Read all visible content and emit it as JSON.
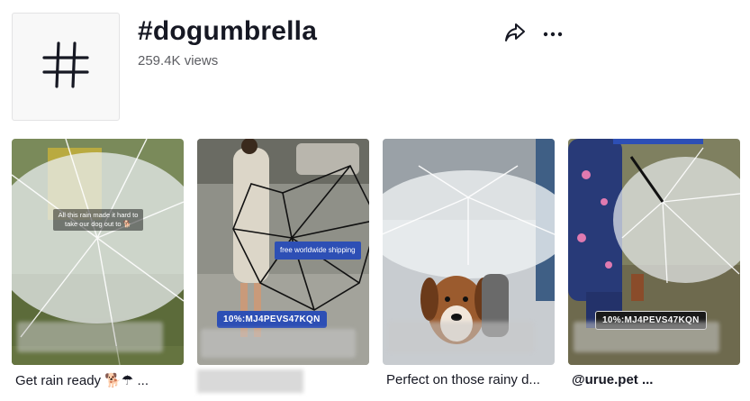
{
  "header": {
    "title": "#dogumbrella",
    "views": "259.4K views",
    "hashtag_icon": "hashtag-icon",
    "share_icon": "share-arrow-icon",
    "more_icon": "more-dots-icon"
  },
  "videos": [
    {
      "overlay_text": "All this rain made it hard to take our dog out to 🐕",
      "caption": "Get rain ready 🐕☂ ..."
    },
    {
      "promo_badge": "free worldwide shipping",
      "promo_code": "10%:MJ4PEVS47KQN",
      "caption": ""
    },
    {
      "caption": "Perfect on those rainy d..."
    },
    {
      "promo_code": "10%:MJ4PEVS47KQN",
      "caption": "@urue.pet ..."
    }
  ],
  "colors": {
    "text_primary": "#161823",
    "text_secondary": "#5c5d62",
    "promo_blue": "#2d4fb5"
  }
}
